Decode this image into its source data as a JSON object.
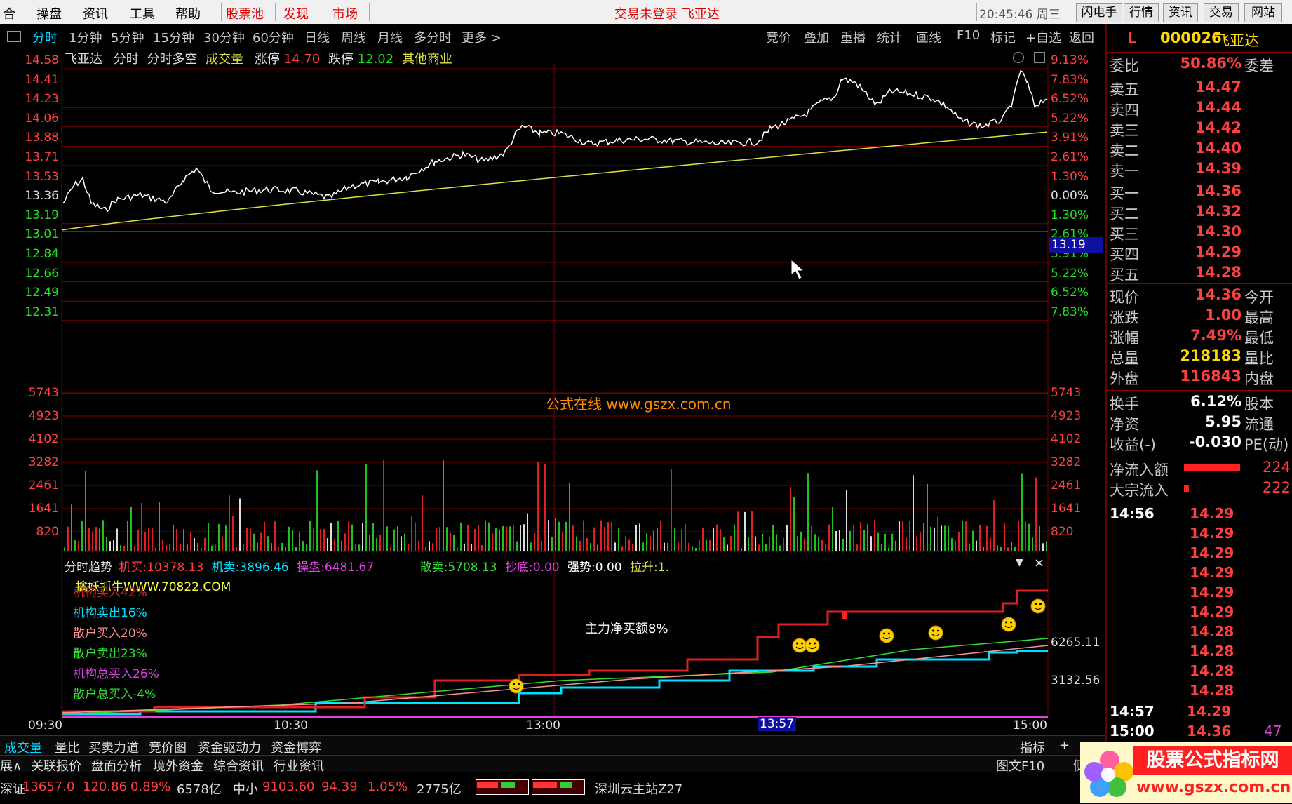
{
  "menubar": {
    "items": [
      "合",
      "操盘",
      "资讯",
      "工具",
      "帮助"
    ],
    "red_items": [
      "股票池",
      "发现",
      "市场"
    ],
    "center_text": "交易未登录  飞亚达",
    "clock": "20:45:46 周三",
    "right_buttons": [
      "闪电手",
      "行情",
      "资讯",
      "交易",
      "网站"
    ]
  },
  "toolbar": {
    "periods": [
      "分时",
      "1分钟",
      "5分钟",
      "15分钟",
      "30分钟",
      "60分钟",
      "日线",
      "周线",
      "月线",
      "多分时",
      "更多 >"
    ],
    "tools": [
      "竞价",
      "叠加",
      "重播",
      "统计",
      "画线",
      "F10",
      "标记",
      "+自选",
      "返回"
    ]
  },
  "chart_header": {
    "name": "飞亚达",
    "mode": "分时",
    "mode2": "分时多空",
    "volume_label": "成交量",
    "limit_up_label": "涨停",
    "limit_up_value": "14.70",
    "limit_down_label": "跌停",
    "limit_down_value": "12.02",
    "sector": "其他商业"
  },
  "price_axis": {
    "left": [
      "14.58",
      "14.41",
      "14.23",
      "14.06",
      "13.88",
      "13.71",
      "13.53",
      "13.36",
      "13.19",
      "13.01",
      "12.84",
      "12.66",
      "12.49",
      "12.31"
    ],
    "right": [
      "9.13%",
      "7.83%",
      "6.52%",
      "5.22%",
      "3.91%",
      "2.61%",
      "1.30%",
      "0.00%",
      "1.30%",
      "2.61%",
      "3.91%",
      "5.22%",
      "6.52%",
      "7.83%"
    ],
    "cursor_value": "13.19"
  },
  "volume_axis": [
    "5743",
    "4923",
    "4102",
    "3282",
    "2461",
    "1641",
    "820"
  ],
  "watermark_center": "公式在线  www.gszx.com.cn",
  "indicator": {
    "title": "分时趋势",
    "stats": [
      {
        "label": "机买:",
        "value": "10378.13"
      },
      {
        "label": "机卖:",
        "value": "3896.46"
      },
      {
        "label": "操盘:",
        "value": "6481.67"
      },
      {
        "label": "散卖:",
        "value": "5708.13"
      },
      {
        "label": "抄底:",
        "value": "0.00"
      },
      {
        "label": "强势:",
        "value": "0.00"
      },
      {
        "label": "拉升:",
        "value": "1."
      }
    ],
    "watermark": "擒妖抓牛WWW.70822.COM",
    "legend": [
      {
        "text": "机构买入42%",
        "color": "#e02020"
      },
      {
        "text": "机构卖出16%",
        "color": "#00e0ff"
      },
      {
        "text": "散户买入20%",
        "color": "#ff9090"
      },
      {
        "text": "散户卖出23%",
        "color": "#30e030"
      },
      {
        "text": "机构总买入26%",
        "color": "#e040e0"
      },
      {
        "text": "散户总买入-4%",
        "color": "#30e030"
      }
    ],
    "center_label": "主力净买额8%",
    "right_axis": [
      "6265.11",
      "3132.56"
    ]
  },
  "time_axis": [
    "09:30",
    "10:30",
    "13:00",
    "15:00"
  ],
  "time_cursor": "13:57",
  "quote": {
    "code": "000026",
    "name": "飞亚达",
    "market_flag": "L",
    "weibi_label": "委比",
    "weibi_value": "50.86%",
    "weicha_label": "委差",
    "asks": [
      {
        "label": "卖五",
        "price": "14.47"
      },
      {
        "label": "卖四",
        "price": "14.44"
      },
      {
        "label": "卖三",
        "price": "14.42"
      },
      {
        "label": "卖二",
        "price": "14.40"
      },
      {
        "label": "卖一",
        "price": "14.39"
      }
    ],
    "bids": [
      {
        "label": "买一",
        "price": "14.36"
      },
      {
        "label": "买二",
        "price": "14.32"
      },
      {
        "label": "买三",
        "price": "14.30"
      },
      {
        "label": "买四",
        "price": "14.29"
      },
      {
        "label": "买五",
        "price": "14.28"
      }
    ],
    "stats1": [
      {
        "label": "现价",
        "value": "14.36",
        "label2": "今开",
        "color": "#ff4040"
      },
      {
        "label": "涨跌",
        "value": "1.00",
        "label2": "最高",
        "color": "#ff4040"
      },
      {
        "label": "涨幅",
        "value": "7.49%",
        "label2": "最低",
        "color": "#ff4040"
      },
      {
        "label": "总量",
        "value": "218183",
        "label2": "量比",
        "color": "#ffd800"
      },
      {
        "label": "外盘",
        "value": "116843",
        "label2": "内盘",
        "color": "#ff4040"
      }
    ],
    "stats2": [
      {
        "label": "换手",
        "value": "6.12%",
        "label2": "股本",
        "color": "#ffffff"
      },
      {
        "label": "净资",
        "value": "5.95",
        "label2": "流通",
        "color": "#ffffff"
      },
      {
        "label": "收益(-)",
        "value": "-0.030",
        "label2": "PE(动)",
        "color": "#ffffff"
      }
    ],
    "flows": [
      {
        "label": "净流入额",
        "value": "224",
        "bar": 0.93
      },
      {
        "label": "大宗流入",
        "value": "222",
        "bar": 0.08
      }
    ],
    "ticks_time": "14:56",
    "ticks": [
      "14.29",
      "14.29",
      "14.29",
      "14.29",
      "14.29",
      "14.29",
      "14.28",
      "14.28",
      "14.28",
      "14.28"
    ],
    "tick2_time": "14:57",
    "tick2_price": "14.29",
    "tick3_time": "15:00",
    "tick3_price": "14.36",
    "tick3_vol": "47"
  },
  "bottom_tabs1": [
    "成交量",
    "量比",
    "买卖力道",
    "竞价图",
    "资金驱动力",
    "资金博弈"
  ],
  "bottom_right1": [
    "指标",
    "+"
  ],
  "bottom_tabs2": [
    "展∧",
    "关联报价",
    "盘面分析",
    "境外资金",
    "综合资讯",
    "行业资讯"
  ],
  "bottom_right2": [
    "图文F10",
    "侧边"
  ],
  "status": {
    "idx1_name": "深证",
    "idx1_vals": [
      "13657.0",
      "120.86",
      "0.89%"
    ],
    "idx1_amt": "6578亿",
    "idx2_name": "中小",
    "idx2_vals": [
      "9103.60",
      "94.39",
      "1.05%"
    ],
    "idx2_amt": "2775亿",
    "server": "深圳云主站Z27"
  },
  "logo_text": "股票公式指标网",
  "logo_url": "www.gszx.com.cn",
  "colors": {
    "up": "#ff4040",
    "down": "#20e020",
    "price_line": "#ffffff",
    "avg_line": "#e0e040",
    "grid": "#7a0000"
  }
}
